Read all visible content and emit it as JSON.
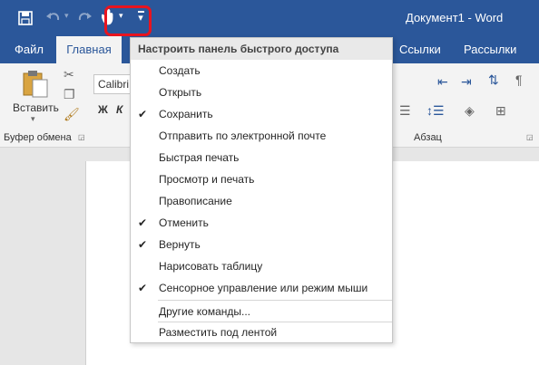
{
  "window": {
    "title": "Документ1 - Word"
  },
  "qat": {
    "save_icon": "save-icon",
    "undo_icon": "undo-icon",
    "redo_icon": "redo-icon",
    "touch_icon": "touch-mode-icon",
    "customize_icon": "customize-qat-icon"
  },
  "tabs": {
    "file": "Файл",
    "home": "Главная",
    "links": "Ссылки",
    "mailings": "Рассылки"
  },
  "ribbon": {
    "paste_label": "Вставить",
    "clipboard_group": "Буфер обмена",
    "font_name": "Calibri",
    "bold": "Ж",
    "italic": "К",
    "paragraph_group": "Абзац"
  },
  "dropdown": {
    "header": "Настроить панель быстрого доступа",
    "items": [
      {
        "label": "Создать",
        "checked": false
      },
      {
        "label": "Открыть",
        "checked": false
      },
      {
        "label": "Сохранить",
        "checked": true
      },
      {
        "label": "Отправить по электронной почте",
        "checked": false
      },
      {
        "label": "Быстрая печать",
        "checked": false
      },
      {
        "label": "Просмотр и печать",
        "checked": false
      },
      {
        "label": "Правописание",
        "checked": false
      },
      {
        "label": "Отменить",
        "checked": true
      },
      {
        "label": "Вернуть",
        "checked": true
      },
      {
        "label": "Нарисовать таблицу",
        "checked": false
      },
      {
        "label": "Сенсорное управление или режим мыши",
        "checked": true
      }
    ],
    "more_commands": "Другие команды...",
    "below_ribbon": "Разместить под лентой"
  },
  "colors": {
    "title_bar": "#2b579a",
    "highlight": "#e8141f"
  }
}
